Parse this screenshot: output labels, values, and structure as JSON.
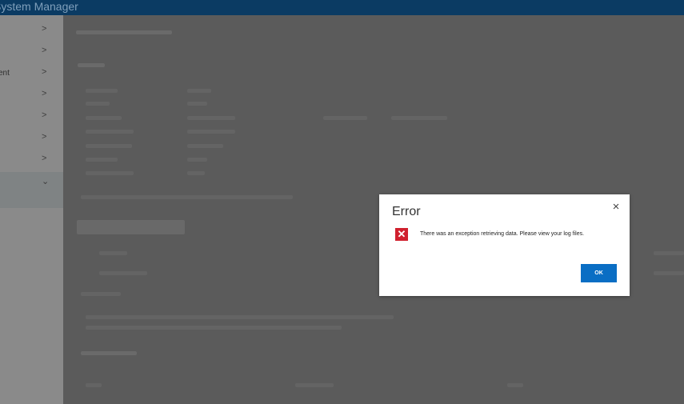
{
  "app": {
    "title": "System Manager"
  },
  "sidebar": {
    "items": [
      {
        "label": "",
        "chevron": ">"
      },
      {
        "label": "",
        "chevron": ">"
      },
      {
        "label": "ent",
        "chevron": ">"
      },
      {
        "label": "",
        "chevron": ">"
      },
      {
        "label": "",
        "chevron": ">"
      },
      {
        "label": "",
        "chevron": ">"
      },
      {
        "label": "",
        "chevron": ">"
      },
      {
        "label": "",
        "chevron": "⌄"
      }
    ]
  },
  "dialog": {
    "title": "Error",
    "close_glyph": "×",
    "icon": "error-x-icon",
    "icon_glyph": "✕",
    "message": "There was an exception retrieving data. Please view your log files.",
    "ok_label": "OK"
  },
  "colors": {
    "topbar": "#0b3b63",
    "ok_button": "#0a6ec4",
    "error_icon": "#d0202e"
  }
}
